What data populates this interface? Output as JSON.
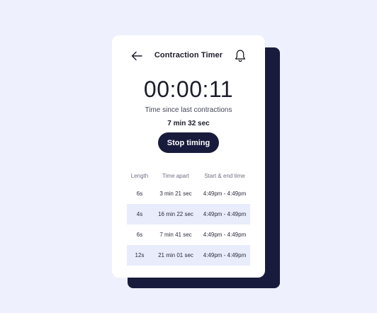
{
  "header": {
    "title": "Contraction Timer",
    "back_icon": "arrow-left-icon",
    "bell_icon": "bell-icon"
  },
  "timer": {
    "display": "00:00:11",
    "since_label": "Time since last contractions",
    "since_value": "7 min 32 sec",
    "stop_label": "Stop timing"
  },
  "table": {
    "headers": [
      "Length",
      "Time apart",
      "Start & end time"
    ],
    "rows": [
      [
        "6s",
        "3 min 21 sec",
        "4:49pm - 4:49pm"
      ],
      [
        "4s",
        "16 min 22 sec",
        "4:49pm - 4:49pm"
      ],
      [
        "6s",
        "7 min 41 sec",
        "4:49pm - 4:49pm"
      ],
      [
        "12s",
        "21 min 01 sec",
        "4:49pm - 4:49pm"
      ]
    ]
  },
  "colors": {
    "background": "#eef1fd",
    "accent_dark": "#181b3b",
    "row_shade": "#e9ecfb"
  }
}
